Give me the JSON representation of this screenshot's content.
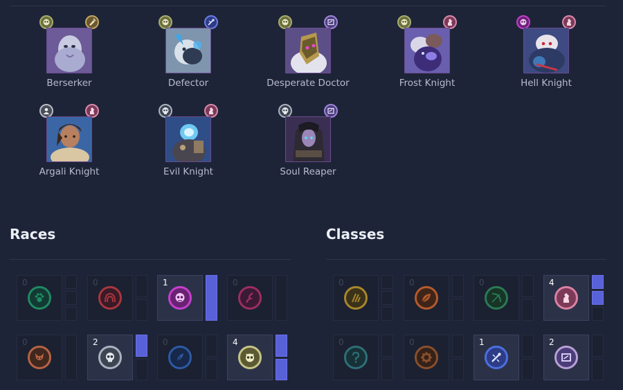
{
  "heroes": [
    {
      "name": "Berserker",
      "race": "beast",
      "cls": "warrior"
    },
    {
      "name": "Defector",
      "race": "beast",
      "cls": "mage"
    },
    {
      "name": "Desperate Doctor",
      "race": "beast",
      "cls": "wizard"
    },
    {
      "name": "Frost Knight",
      "race": "beast",
      "cls": "knight"
    },
    {
      "name": "Hell Knight",
      "race": "demon",
      "cls": "knight"
    },
    {
      "name": "Argali Knight",
      "race": "human",
      "cls": "knight"
    },
    {
      "name": "Evil Knight",
      "race": "undead",
      "cls": "knight"
    },
    {
      "name": "Soul Reaper",
      "race": "undead",
      "cls": "wizard"
    }
  ],
  "races": {
    "title": "Races",
    "items": [
      {
        "icon": "paw-icon",
        "count": "0",
        "active": false,
        "color": "#1f8a63",
        "bars": 3,
        "filled": 0
      },
      {
        "icon": "arch-icon",
        "count": "0",
        "active": false,
        "color": "#a8363f",
        "bars": 2,
        "filled": 0
      },
      {
        "icon": "demon-skull-icon",
        "count": "1",
        "active": true,
        "color": "#c63fcf",
        "bars": 1,
        "filled": 1
      },
      {
        "icon": "slash-icon",
        "count": "0",
        "active": false,
        "color": "#9d2d63",
        "bars": 1,
        "filled": 0
      },
      {
        "icon": "fox-icon",
        "count": "0",
        "active": false,
        "color": "#b76244",
        "bars": 1,
        "filled": 0
      },
      {
        "icon": "skull-icon",
        "count": "2",
        "active": true,
        "color": "#a9b2bf",
        "bars": 2,
        "filled": 1
      },
      {
        "icon": "feather-icon",
        "count": "0",
        "active": false,
        "color": "#2e5aa6",
        "bars": 2,
        "filled": 0
      },
      {
        "icon": "beast-face-icon",
        "count": "4",
        "active": true,
        "color": "#c6c486",
        "bars": 2,
        "filled": 2
      }
    ]
  },
  "classes": {
    "title": "Classes",
    "items": [
      {
        "icon": "claw-icon",
        "count": "0",
        "active": false,
        "color": "#a8862b",
        "bars": 3,
        "filled": 0
      },
      {
        "icon": "leaf-icon",
        "count": "0",
        "active": false,
        "color": "#b55a2c",
        "bars": 2,
        "filled": 0
      },
      {
        "icon": "bow-icon",
        "count": "0",
        "active": false,
        "color": "#2b7a55",
        "bars": 2,
        "filled": 0
      },
      {
        "icon": "knight-piece-icon",
        "count": "4",
        "active": true,
        "color": "#d982a2",
        "bars": 3,
        "filled": 2
      },
      {
        "icon": "hook-icon",
        "count": "0",
        "active": false,
        "color": "#2e6f78",
        "bars": 2,
        "filled": 0
      },
      {
        "icon": "gear-icon",
        "count": "0",
        "active": false,
        "color": "#8a4f2c",
        "bars": 2,
        "filled": 0
      },
      {
        "icon": "mage-icon",
        "count": "1",
        "active": true,
        "color": "#4c6fe0",
        "bars": 2,
        "filled": 0
      },
      {
        "icon": "book-icon",
        "count": "2",
        "active": true,
        "color": "#b8a0d6",
        "bars": 2,
        "filled": 0
      }
    ]
  }
}
